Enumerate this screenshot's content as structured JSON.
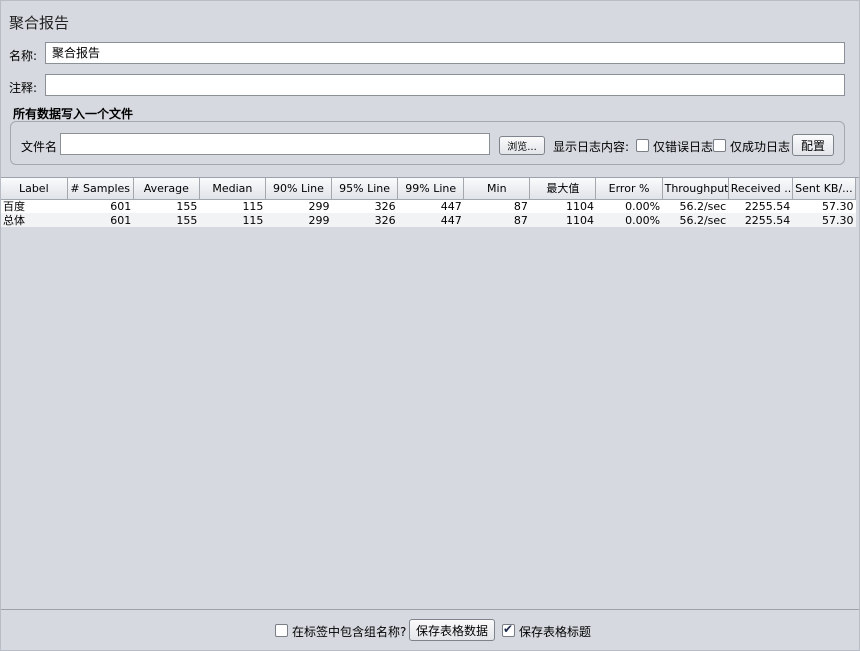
{
  "panel": {
    "title": "聚合报告",
    "name_label": "名称:",
    "name_value": "聚合报告",
    "comment_label": "注释:",
    "comment_value": ""
  },
  "file_section": {
    "title": "所有数据写入一个文件",
    "filename_label": "文件名",
    "filename_value": "",
    "browse_label": "浏览...",
    "log_display_label": "显示日志内容:",
    "errors_only_label": "仅错误日志",
    "errors_only_checked": false,
    "success_only_label": "仅成功日志",
    "success_only_checked": false,
    "configure_label": "配置"
  },
  "table": {
    "columns": [
      "Label",
      "# Samples",
      "Average",
      "Median",
      "90% Line",
      "95% Line",
      "99% Line",
      "Min",
      "最大值",
      "Error %",
      "Throughput",
      "Received ...",
      "Sent KB/..."
    ],
    "rows": [
      [
        "百度",
        "601",
        "155",
        "115",
        "299",
        "326",
        "447",
        "87",
        "1104",
        "0.00%",
        "56.2/sec",
        "2255.54",
        "57.30"
      ],
      [
        "总体",
        "601",
        "155",
        "115",
        "299",
        "326",
        "447",
        "87",
        "1104",
        "0.00%",
        "56.2/sec",
        "2255.54",
        "57.30"
      ]
    ]
  },
  "footer": {
    "include_group_label": "在标签中包含组名称?",
    "include_group_checked": false,
    "save_table_label": "保存表格数据",
    "save_header_label": "保存表格标题",
    "save_header_checked": true
  }
}
